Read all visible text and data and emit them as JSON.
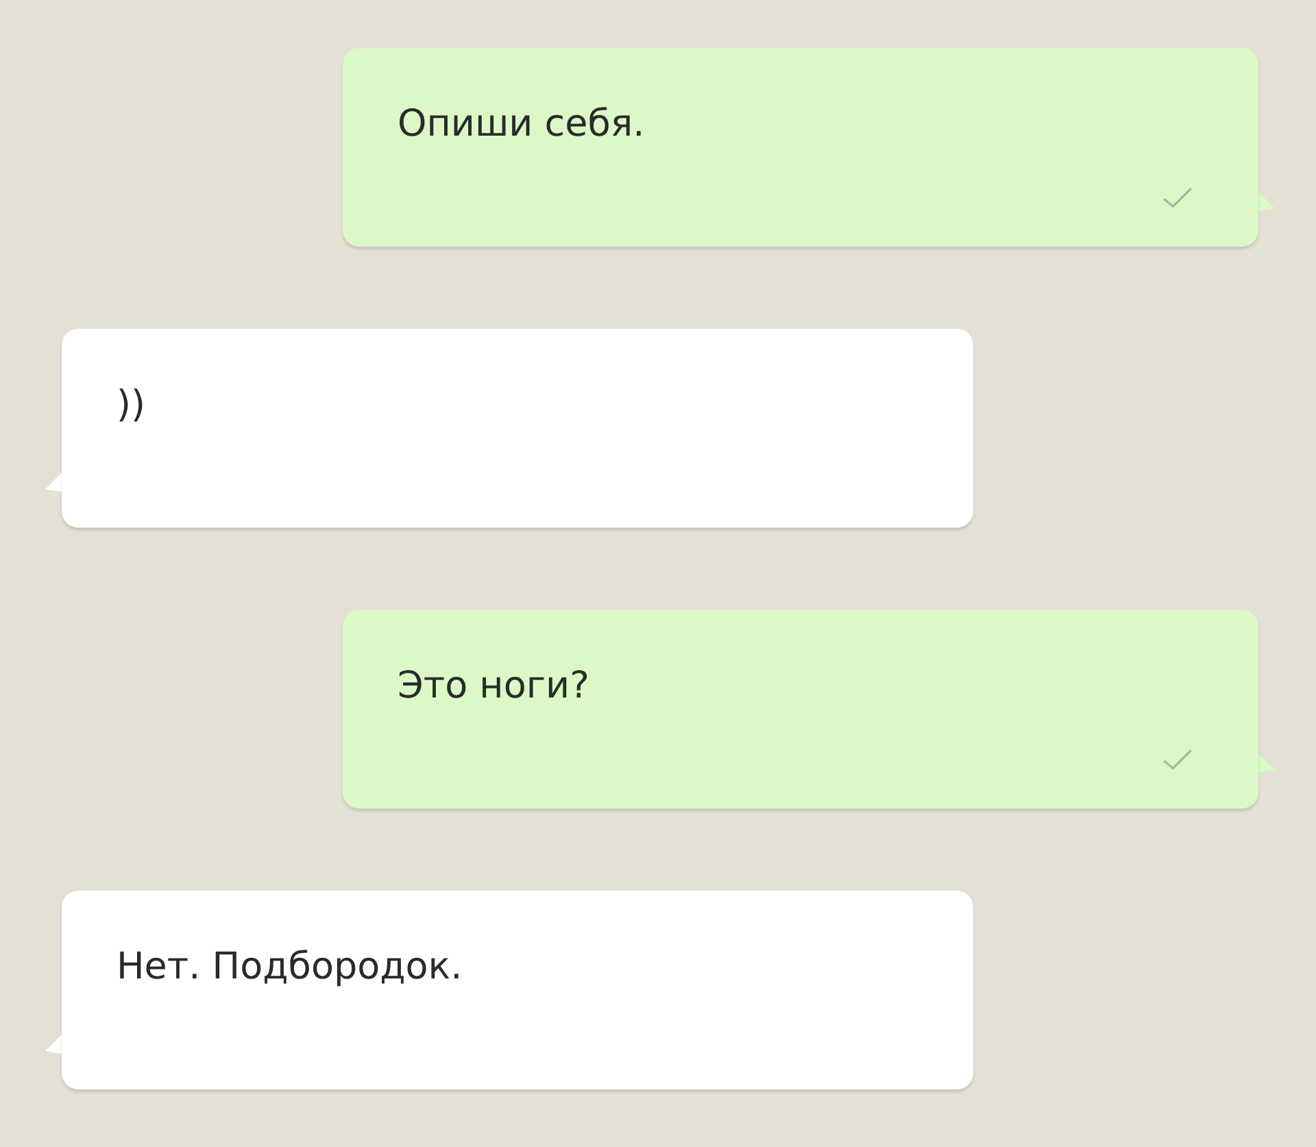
{
  "messages": [
    {
      "kind": "outgoing",
      "text": "Опиши себя.",
      "delivered": true
    },
    {
      "kind": "incoming",
      "text": "))"
    },
    {
      "kind": "outgoing",
      "text": "Это ноги?",
      "delivered": true
    },
    {
      "kind": "incoming",
      "text": "Нет. Подбородок."
    }
  ]
}
